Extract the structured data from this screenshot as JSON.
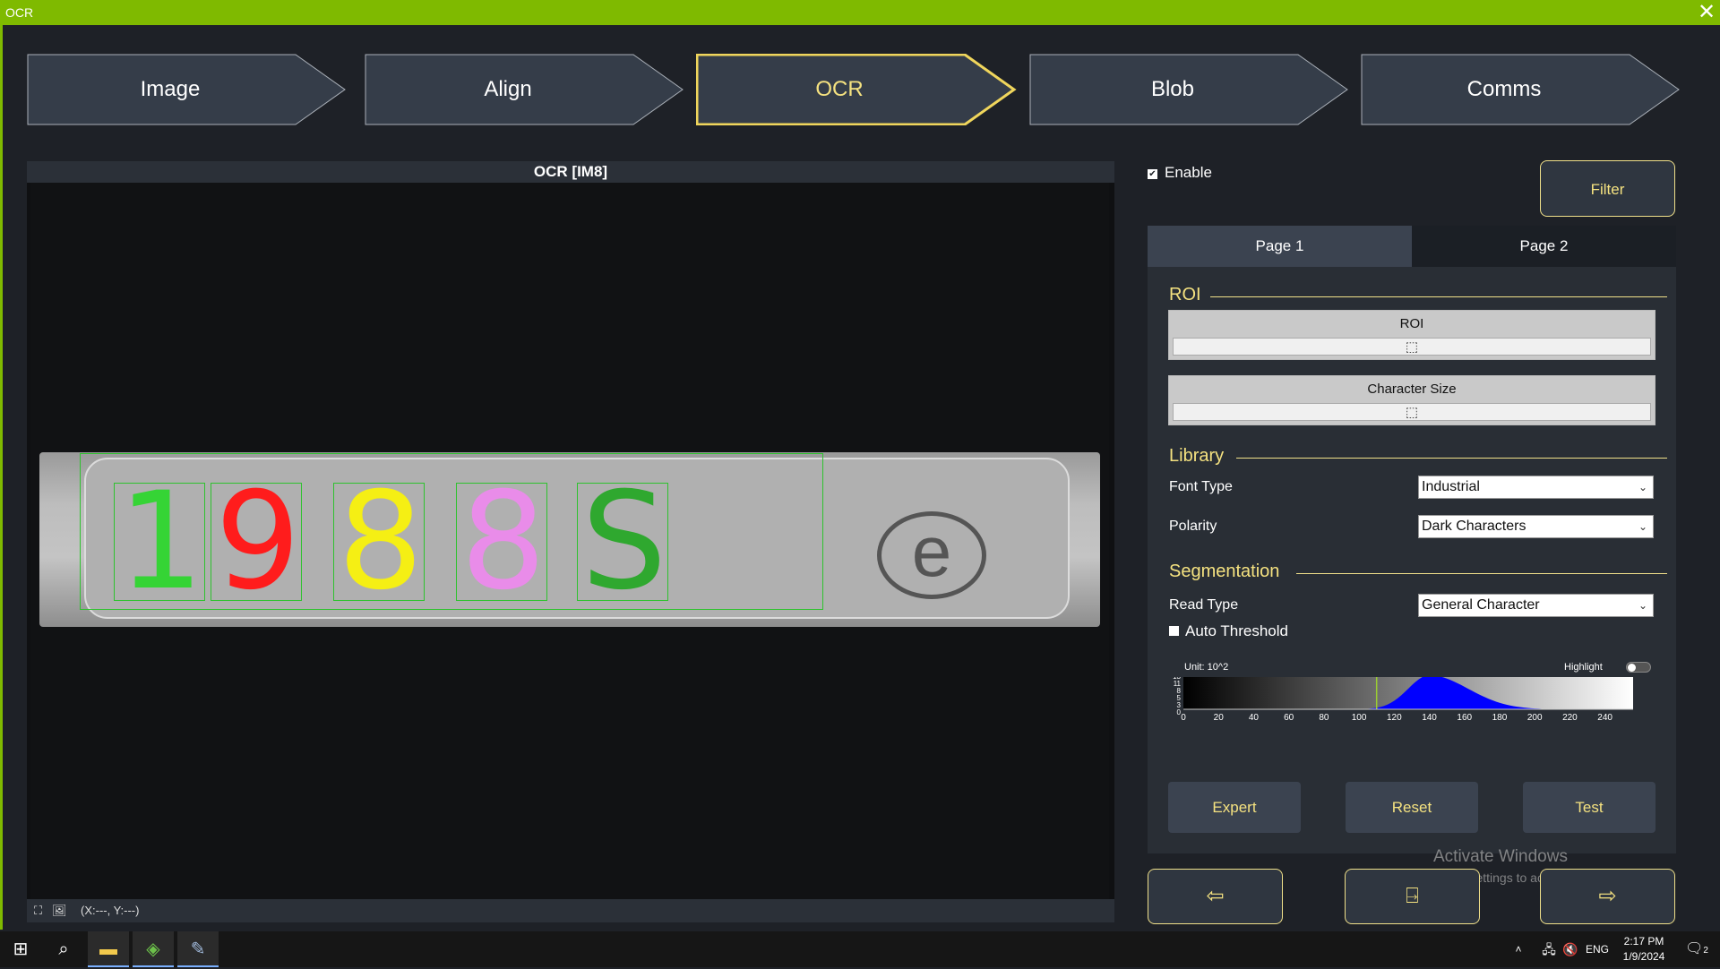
{
  "window": {
    "title": "OCR",
    "close_icon": "close-icon"
  },
  "steps": [
    {
      "label": "Image",
      "active": false
    },
    {
      "label": "Align",
      "active": false
    },
    {
      "label": "OCR",
      "active": true
    },
    {
      "label": "Blob",
      "active": false
    },
    {
      "label": "Comms",
      "active": false
    }
  ],
  "viewer": {
    "title": "OCR  [IM8]",
    "coords": "(X:---, Y:---)",
    "characters": [
      {
        "char": "1",
        "color": "#35d435"
      },
      {
        "char": "9",
        "color": "#ff1c1c"
      },
      {
        "char": "8",
        "color": "#f5ef14"
      },
      {
        "char": "8",
        "color": "#e98ce9"
      },
      {
        "char": "S",
        "color": "#2fa82f"
      }
    ]
  },
  "panel": {
    "enable_label": "Enable",
    "enable_checked": true,
    "filter_label": "Filter",
    "tabs": [
      "Page 1",
      "Page 2"
    ],
    "roi_section": "ROI",
    "roi_label": "ROI",
    "char_size_label": "Character Size",
    "library_section": "Library",
    "font_type_label": "Font Type",
    "font_type_value": "Industrial",
    "polarity_label": "Polarity",
    "polarity_value": "Dark Characters",
    "segmentation_section": "Segmentation",
    "read_type_label": "Read Type",
    "read_type_value": "General Character",
    "auto_threshold_label": "Auto Threshold",
    "auto_threshold_checked": false,
    "hist_unit": "Unit: 10^2",
    "highlight_label": "Highlight",
    "highlight_on": false,
    "hist_yticks": [
      "13",
      "11",
      "8",
      "5",
      "3",
      "0"
    ],
    "hist_xticks": [
      "0",
      "20",
      "40",
      "60",
      "80",
      "100",
      "120",
      "140",
      "160",
      "180",
      "200",
      "220",
      "240"
    ],
    "threshold": 110,
    "expert_label": "Expert",
    "reset_label": "Reset",
    "test_label": "Test"
  },
  "nav": {
    "back_icon": "arrow-left-icon",
    "exit_icon": "exit-door-icon",
    "next_icon": "arrow-right-icon"
  },
  "watermark": {
    "line1": "Activate Windows",
    "line2": "Go to Settings to activate Windows."
  },
  "taskbar": {
    "lang": "ENG",
    "time": "2:17 PM",
    "date": "1/9/2024",
    "notif_count": "2"
  }
}
